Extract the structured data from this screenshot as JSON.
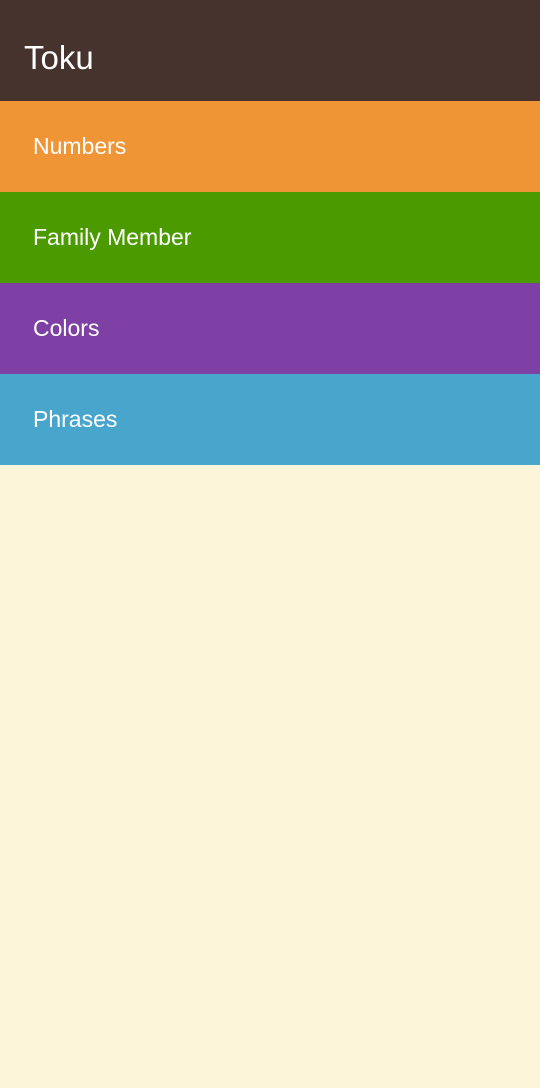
{
  "app_bar": {
    "title": "Toku",
    "background": "#47332E"
  },
  "categories": [
    {
      "label": "Numbers",
      "color": "#EF9535"
    },
    {
      "label": "Family Member",
      "color": "#4A9A00"
    },
    {
      "label": "Colors",
      "color": "#7E40A4"
    },
    {
      "label": "Phrases",
      "color": "#48A5CC"
    }
  ],
  "body_background": "#FDF5DA"
}
